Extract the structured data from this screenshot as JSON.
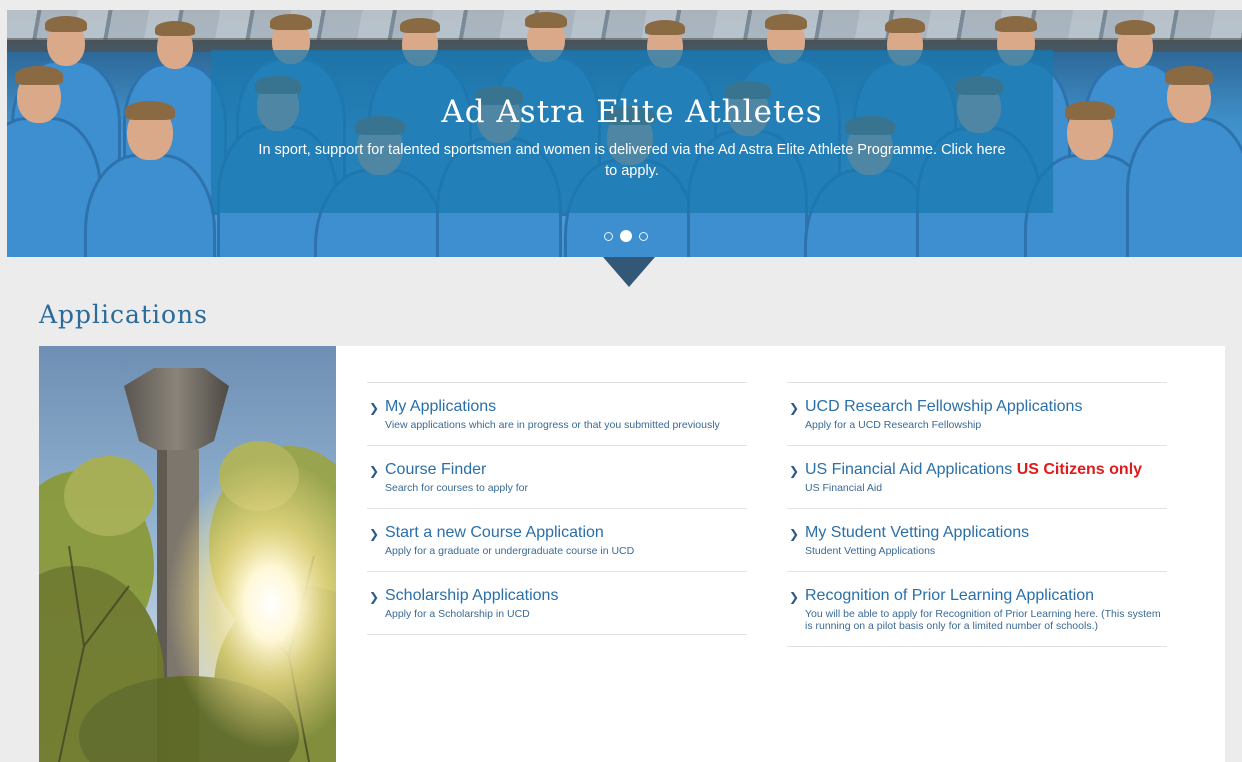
{
  "hero": {
    "title": "Ad Astra Elite Athletes",
    "subtitle": "In sport, support for talented sportsmen and women is delivered via the Ad Astra Elite Athlete Programme. Click here to apply.",
    "slides_total": 3,
    "active_slide": 2
  },
  "applications": {
    "title": "Applications",
    "left_items": [
      {
        "title": "My Applications",
        "desc": "View applications which are in progress or that you submitted previously"
      },
      {
        "title": "Course Finder",
        "desc": "Search for courses to apply for"
      },
      {
        "title": "Start a new Course Application",
        "desc": "Apply for a graduate or undergraduate course in UCD"
      },
      {
        "title": "Scholarship Applications",
        "desc": "Apply for a Scholarship in UCD"
      }
    ],
    "right_items": [
      {
        "title": "UCD Research Fellowship Applications",
        "desc": "Apply for a UCD Research Fellowship"
      },
      {
        "title": "US Financial Aid Applications",
        "flag": "US Citizens only",
        "desc": "US Financial Aid"
      },
      {
        "title": "My Student Vetting Applications",
        "desc": "Student Vetting Applications"
      },
      {
        "title": "Recognition of Prior Learning Application",
        "desc": "You will be able to apply for Recognition of Prior Learning here. (This system is running on a pilot basis only for a limited number of schools.)"
      }
    ]
  },
  "colors": {
    "link_blue": "#2a6fa8",
    "heading_blue": "#2a6b9a",
    "alert_red": "#e01b1b",
    "overlay_blue": "#1978af"
  }
}
